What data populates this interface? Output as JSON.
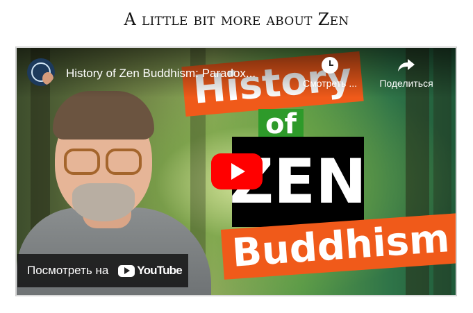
{
  "page": {
    "heading": "A little bit more about Zen"
  },
  "video": {
    "title": "History of Zen Buddhism: Paradox...",
    "watch_later_label": "Смотреть ...",
    "share_label": "Поделиться",
    "watch_on_label": "Посмотреть на",
    "youtube_wordmark": "YouTube",
    "thumbnail_text": {
      "line1": "History",
      "line2": "of",
      "line3": "ZEN",
      "line4": "Buddhism"
    },
    "icons": [
      "channel-avatar",
      "clock-icon",
      "share-arrow-icon",
      "play-icon",
      "youtube-logo-icon"
    ],
    "colors": {
      "play_button": "#ff0000",
      "title_orange": "#f05a1a",
      "title_green": "#2e9a2a",
      "title_black": "#000000"
    }
  }
}
